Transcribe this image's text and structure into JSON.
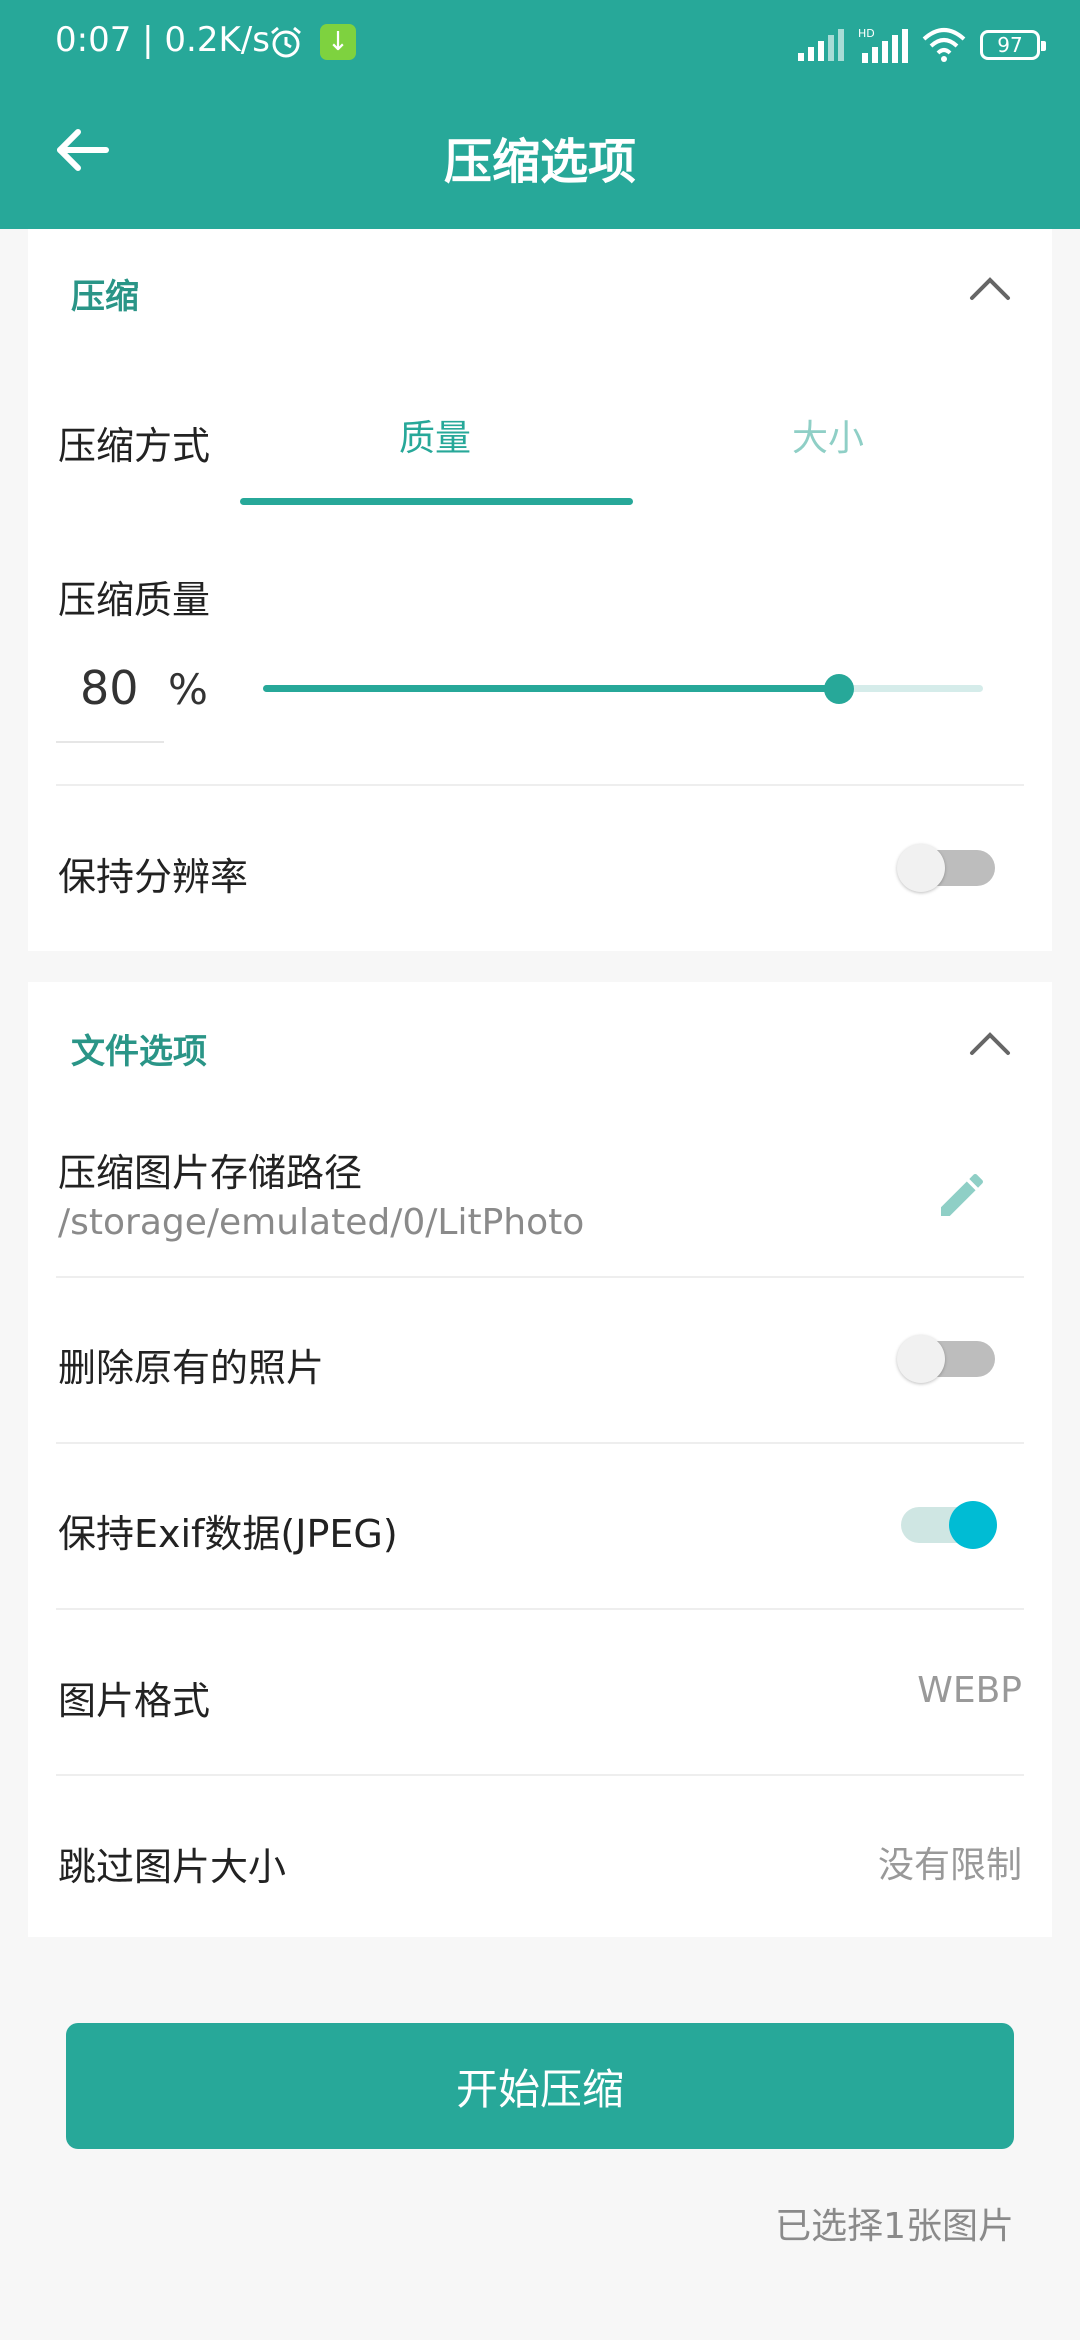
{
  "status": {
    "time_speed": "0:07 | 0.2K/s",
    "battery": "97"
  },
  "header": {
    "title": "压缩选项"
  },
  "compression": {
    "section_title": "压缩",
    "method_label": "压缩方式",
    "tabs": [
      "质量",
      "大小"
    ],
    "selected_tab": "质量",
    "quality_label": "压缩质量",
    "quality_value": "80",
    "quality_unit": "%",
    "quality_percent": 80,
    "keep_resolution_label": "保持分辨率",
    "keep_resolution_on": false
  },
  "file_options": {
    "section_title": "文件选项",
    "save_path_label": "压缩图片存储路径",
    "save_path_value": "/storage/emulated/0/LitPhoto",
    "delete_original_label": "删除原有的照片",
    "delete_original_on": false,
    "keep_exif_label": "保持Exif数据(JPEG)",
    "keep_exif_on": true,
    "format_label": "图片格式",
    "format_value": "WEBP",
    "skip_size_label": "跳过图片大小",
    "skip_size_value": "没有限制"
  },
  "footer": {
    "start_button": "开始压缩",
    "selected_count": "已选择1张图片"
  },
  "colors": {
    "primary": "#27a899",
    "accent": "#00bcd4"
  }
}
